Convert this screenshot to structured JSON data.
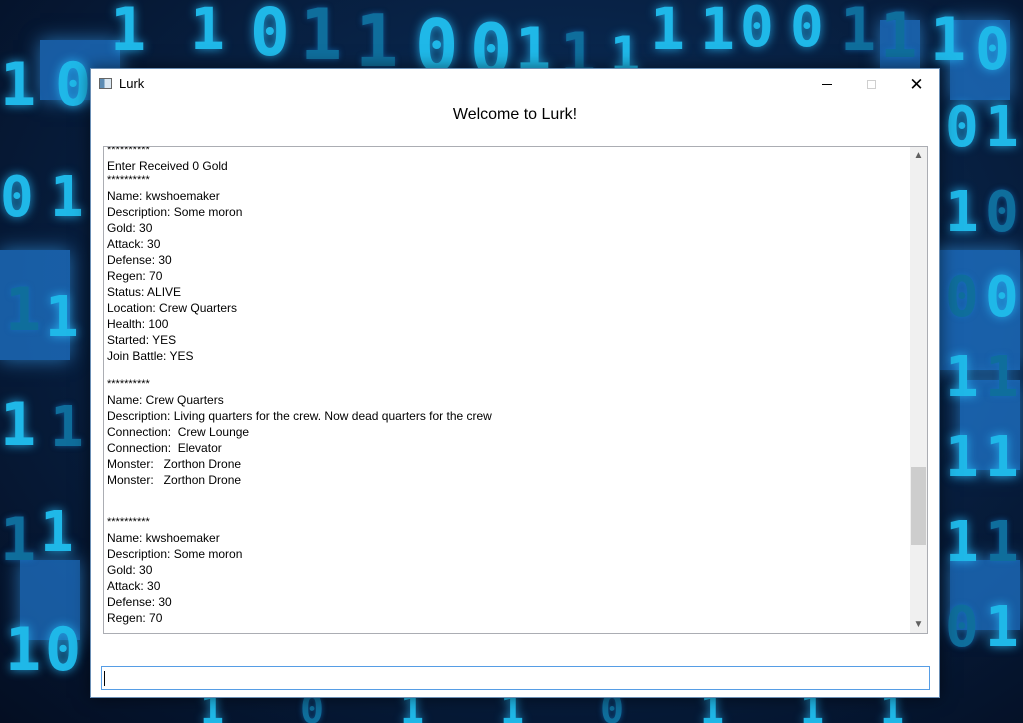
{
  "window": {
    "title": "Lurk",
    "icon": "app-window-icon",
    "controls": {
      "minimize": "minimize-icon",
      "maximize": "maximize-icon",
      "close": "close-icon"
    }
  },
  "heading": "Welcome to Lurk!",
  "log": {
    "lines": [
      {
        "text": "**********",
        "kind": "sep"
      },
      {
        "text": "Enter Received 0 Gold",
        "kind": "text"
      },
      {
        "text": "**********",
        "kind": "sep"
      },
      {
        "text": "Name: kwshoemaker",
        "kind": "text"
      },
      {
        "text": "Description: Some moron",
        "kind": "text"
      },
      {
        "text": "Gold: 30",
        "kind": "text"
      },
      {
        "text": "Attack: 30",
        "kind": "text"
      },
      {
        "text": "Defense: 30",
        "kind": "text"
      },
      {
        "text": "Regen: 70",
        "kind": "text"
      },
      {
        "text": "Status: ALIVE",
        "kind": "text"
      },
      {
        "text": "Location: Crew Quarters",
        "kind": "text"
      },
      {
        "text": "Health: 100",
        "kind": "text"
      },
      {
        "text": "Started: YES",
        "kind": "text"
      },
      {
        "text": "Join Battle: YES",
        "kind": "text"
      },
      {
        "text": "",
        "kind": "blank"
      },
      {
        "text": "**********",
        "kind": "sep"
      },
      {
        "text": "Name: Crew Quarters",
        "kind": "text"
      },
      {
        "text": "Description: Living quarters for the crew. Now dead quarters for the crew",
        "kind": "text"
      },
      {
        "text": "Connection:  Crew Lounge",
        "kind": "text"
      },
      {
        "text": "Connection:  Elevator",
        "kind": "text"
      },
      {
        "text": "Monster:   Zorthon Drone",
        "kind": "text"
      },
      {
        "text": "Monster:   Zorthon Drone",
        "kind": "text"
      },
      {
        "text": "",
        "kind": "blank"
      },
      {
        "text": "",
        "kind": "blank"
      },
      {
        "text": "**********",
        "kind": "sep"
      },
      {
        "text": "Name: kwshoemaker",
        "kind": "text"
      },
      {
        "text": "Description: Some moron",
        "kind": "text"
      },
      {
        "text": "Gold: 30",
        "kind": "text"
      },
      {
        "text": "Attack: 30",
        "kind": "text"
      },
      {
        "text": "Defense: 30",
        "kind": "text"
      },
      {
        "text": "Regen: 70",
        "kind": "text"
      }
    ],
    "scroll_position": 0.78
  },
  "input": {
    "value": "",
    "placeholder": ""
  },
  "scrollbar": {
    "up_icon": "scroll-up-arrow-icon",
    "down_icon": "scroll-down-arrow-icon"
  },
  "colors": {
    "window_border": "#6b8fb5",
    "input_focus_border": "#569de5",
    "wallpaper_digits": "#1fb8e8"
  }
}
